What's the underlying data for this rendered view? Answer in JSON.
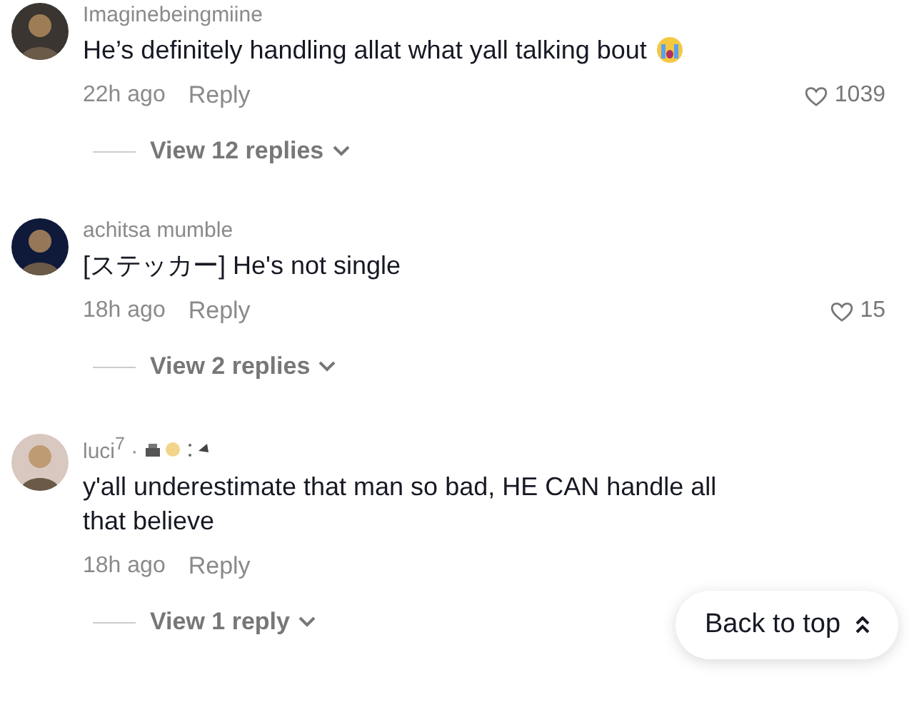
{
  "comments": [
    {
      "username": "Imaginebeingmiine",
      "text": "He’s definitely handling allat what yall talking bout",
      "emoji": true,
      "name_icons": false,
      "time": "22h ago",
      "reply": "Reply",
      "likes": "1039",
      "liked": false,
      "view_replies": "View 12 replies"
    },
    {
      "username": "achitsa mumble",
      "text": "[ステッカー] He's not single",
      "emoji": false,
      "name_icons": false,
      "time": "18h ago",
      "reply": "Reply",
      "likes": "15",
      "liked": false,
      "view_replies": "View 2 replies"
    },
    {
      "username": "luci$^{7}$ ·",
      "text": "y'all underestimate that man so bad, HE CAN handle all that believe",
      "emoji": false,
      "name_icons": true,
      "time": "18h ago",
      "reply": "Reply",
      "view_replies": "View 1 reply"
    }
  ],
  "back_to_top": "Back to top"
}
